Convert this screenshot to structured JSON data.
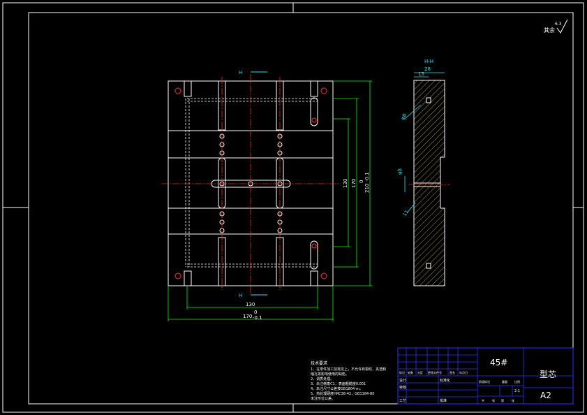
{
  "roughness": {
    "value": "6.3",
    "label": "其余"
  },
  "section_view": {
    "label": "H-H",
    "dim_28": "28",
    "dim_15": "15",
    "dim_phi8": "φ8",
    "dim_phi5": "φ5",
    "dim_11": "11"
  },
  "front_view": {
    "section_mark": "H"
  },
  "dims": {
    "w130": "130",
    "w170": "170",
    "w170_tol_up": "0",
    "w170_tol_dn": "-0.1",
    "h130": "130",
    "h170": "170",
    "h210": "210",
    "h210_tol_up": "0",
    "h210_tol_dn": "-0.1"
  },
  "notes": {
    "title": "技术要求",
    "lines": [
      "1、在零件加工前需见上，不允许有裂纹、夹渣和",
      "   缩孔等影响使用的缺陷。",
      "2、调质处理。",
      "3、未注倒角C1，表面粗糙度0.001",
      "4、未注尺寸公差按GB1804-m。",
      "5、热处理硬度HRC38-42，GB1184-80",
      "   未注形位公差。"
    ]
  },
  "title_block": {
    "material": "45#",
    "part_name": "型芯",
    "sheet": "A2",
    "cells": [
      "设计",
      "标准化",
      "审核",
      "工艺",
      "批准",
      "标记",
      "处数",
      "分区",
      "更改文件号",
      "签名",
      "年月日",
      "阶段标记",
      "重量",
      "比例",
      "共",
      "张",
      "第",
      "张",
      "2:1"
    ]
  },
  "colors": {
    "outline": "#ffffff",
    "center": "#ff2020",
    "dim": "#00ff00",
    "hatch": "#f0e060",
    "title": "#3030ff",
    "cyan": "#19e6ff"
  }
}
